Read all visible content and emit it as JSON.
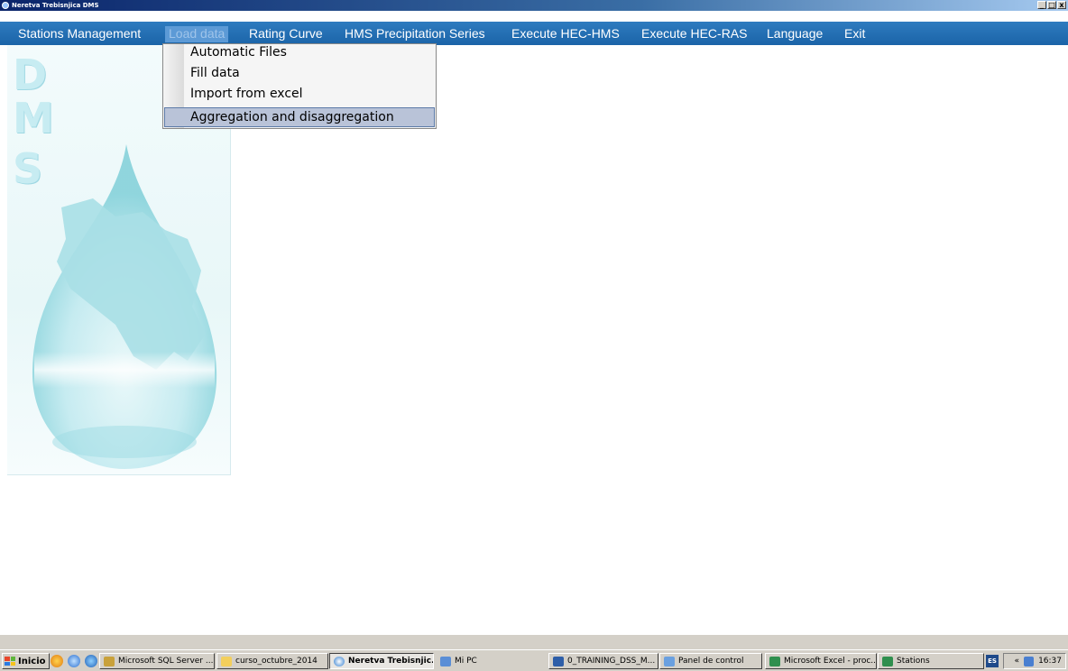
{
  "window": {
    "title": "Neretva Trebisnjica DMS",
    "buttons": [
      "_",
      "□",
      "x"
    ]
  },
  "menu": {
    "items": [
      "Stations Management",
      "Load data",
      "Rating Curve",
      "HMS Precipitation Series",
      "Execute HEC-HMS",
      "Execute HEC-RAS",
      "Language",
      "Exit"
    ],
    "active": "Load data"
  },
  "dropdown": {
    "items": [
      "Automatic Files",
      "Fill data",
      "Import from excel",
      "Aggregation and disaggregation"
    ],
    "highlighted": "Aggregation and disaggregation"
  },
  "panel": {
    "letters": [
      "D",
      "M",
      "S"
    ]
  },
  "taskbar": {
    "start_label": "Inicio",
    "tasks": [
      "Microsoft SQL Server ...",
      "curso_octubre_2014",
      "Neretva Trebisnjic...",
      "Mi PC",
      "0_TRAINING_DSS_M...",
      "Panel de control",
      "Microsoft Excel - proc...",
      "Stations"
    ],
    "active_task": "Neretva Trebisnjic...",
    "language": "ES",
    "clock": "16:37",
    "chevron": "«"
  }
}
